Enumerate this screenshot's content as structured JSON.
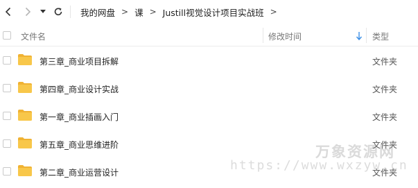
{
  "toolbar": {
    "breadcrumb": [
      "我的网盘",
      "课",
      "Justill视觉设计项目实战班"
    ],
    "separator": ">"
  },
  "header": {
    "name_label": "文件名",
    "time_label": "修改时间",
    "type_label": "类型"
  },
  "rows": [
    {
      "name": "第三章_商业项目拆解",
      "type": "文件夹"
    },
    {
      "name": "第四章_商业设计实战",
      "type": "文件夹"
    },
    {
      "name": "第一章_商业插画入门",
      "type": "文件夹"
    },
    {
      "name": "第五章_商业思维进阶",
      "type": "文件夹"
    },
    {
      "name": "第二章_商业运营设计",
      "type": "文件夹"
    }
  ],
  "watermark": {
    "title": "万象资源网",
    "url": "https://www.wxzyw.cn"
  },
  "colors": {
    "folder": "#f8c74a",
    "folder_tab": "#f0b233",
    "sort_arrow": "#3a8ee6"
  }
}
